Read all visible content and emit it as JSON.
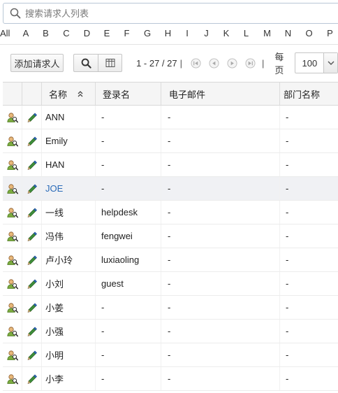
{
  "search": {
    "placeholder": "搜索请求人列表"
  },
  "alphabet": [
    "All",
    "A",
    "B",
    "C",
    "D",
    "E",
    "F",
    "G",
    "H",
    "I",
    "J",
    "K",
    "L",
    "M",
    "N",
    "O",
    "P"
  ],
  "toolbar": {
    "add_label": "添加请求人",
    "pagination": "1 - 27 / 27",
    "separator": "|",
    "per_page_label": "每页",
    "per_page_value": "100"
  },
  "table": {
    "columns": [
      "名称",
      "登录名",
      "电子邮件",
      "部门名称"
    ],
    "rows": [
      {
        "name": "ANN",
        "login": "-",
        "email": "-",
        "dept": "-"
      },
      {
        "name": "Emily",
        "login": "-",
        "email": "-",
        "dept": "-"
      },
      {
        "name": "HAN",
        "login": "-",
        "email": "-",
        "dept": "-"
      },
      {
        "name": "JOE",
        "login": "-",
        "email": "-",
        "dept": "-"
      },
      {
        "name": "一线",
        "login": "helpdesk",
        "email": "-",
        "dept": "-"
      },
      {
        "name": "冯伟",
        "login": "fengwei",
        "email": "-",
        "dept": "-"
      },
      {
        "name": "卢小玲",
        "login": "luxiaoling",
        "email": "-",
        "dept": "-"
      },
      {
        "name": "小刘",
        "login": "guest",
        "email": "-",
        "dept": "-"
      },
      {
        "name": "小姜",
        "login": "-",
        "email": "-",
        "dept": "-"
      },
      {
        "name": "小强",
        "login": "-",
        "email": "-",
        "dept": "-"
      },
      {
        "name": "小明",
        "login": "-",
        "email": "-",
        "dept": "-"
      },
      {
        "name": "小李",
        "login": "-",
        "email": "-",
        "dept": "-"
      }
    ]
  },
  "colors": {
    "link": "#2a6bb8",
    "selected_row": "#f0f1f4"
  }
}
